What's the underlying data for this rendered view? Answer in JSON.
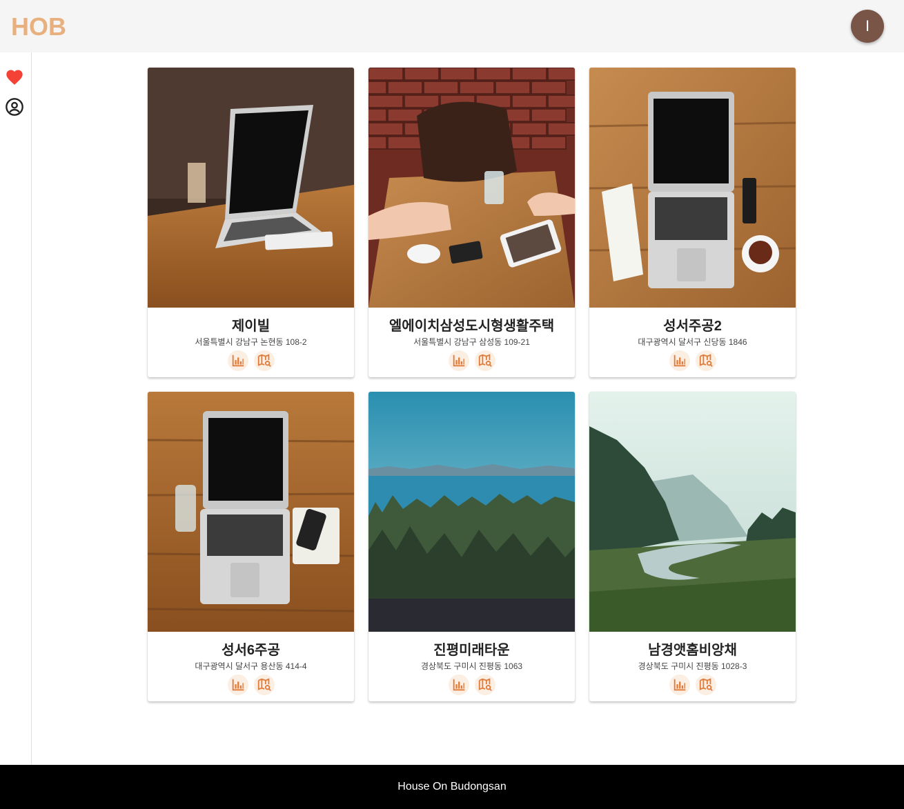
{
  "header": {
    "logo": "HOB",
    "avatar_initial": "I"
  },
  "sidebar": {
    "items": [
      {
        "icon": "heart-icon",
        "color": "#f44336"
      },
      {
        "icon": "user-circle-icon",
        "color": "#222222"
      }
    ]
  },
  "cards": [
    {
      "name": "제이빌",
      "address": "서울특별시 강남구 논현동 108-2"
    },
    {
      "name": "엘에이치삼성도시형생활주택",
      "address": "서울특별시 강남구 삼성동 109-21"
    },
    {
      "name": "성서주공2",
      "address": "대구광역시 달서구 신당동 1846"
    },
    {
      "name": "성서6주공",
      "address": "대구광역시 달서구 용산동 414-4"
    },
    {
      "name": "진평미래타운",
      "address": "경상북도 구미시 진평동 1063"
    },
    {
      "name": "남경앳홈비앙채",
      "address": "경상북도 구미시 진평동 1028-3"
    }
  ],
  "footer": {
    "text": "House On Budongsan"
  },
  "colors": {
    "accent": "#e8b07e",
    "icon_orange": "#e07b39",
    "avatar": "#795548"
  }
}
